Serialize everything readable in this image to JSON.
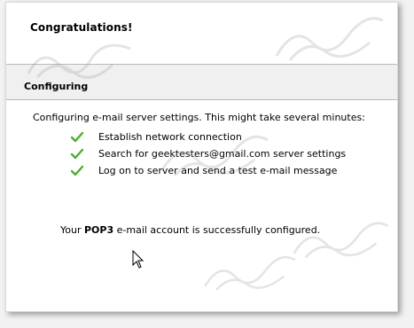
{
  "dialog": {
    "title": "Congratulations!",
    "section_title": "Configuring",
    "intro": "Configuring e-mail server settings. This might take several minutes:",
    "steps": [
      {
        "label": "Establish network connection",
        "status": "done"
      },
      {
        "label": "Search for geektesters@gmail.com server settings",
        "status": "done"
      },
      {
        "label": "Log on to server and send a test e-mail message",
        "status": "done"
      }
    ],
    "result": {
      "prefix": "Your",
      "protocol": "POP3",
      "suffix": "e-mail account is successfully configured."
    }
  },
  "icons": {
    "check": "checkmark-icon",
    "cursor": "mouse-pointer-icon",
    "watermark": "watermark-logo"
  },
  "colors": {
    "check": "#4cae2c",
    "band": "#f0f0f0"
  }
}
